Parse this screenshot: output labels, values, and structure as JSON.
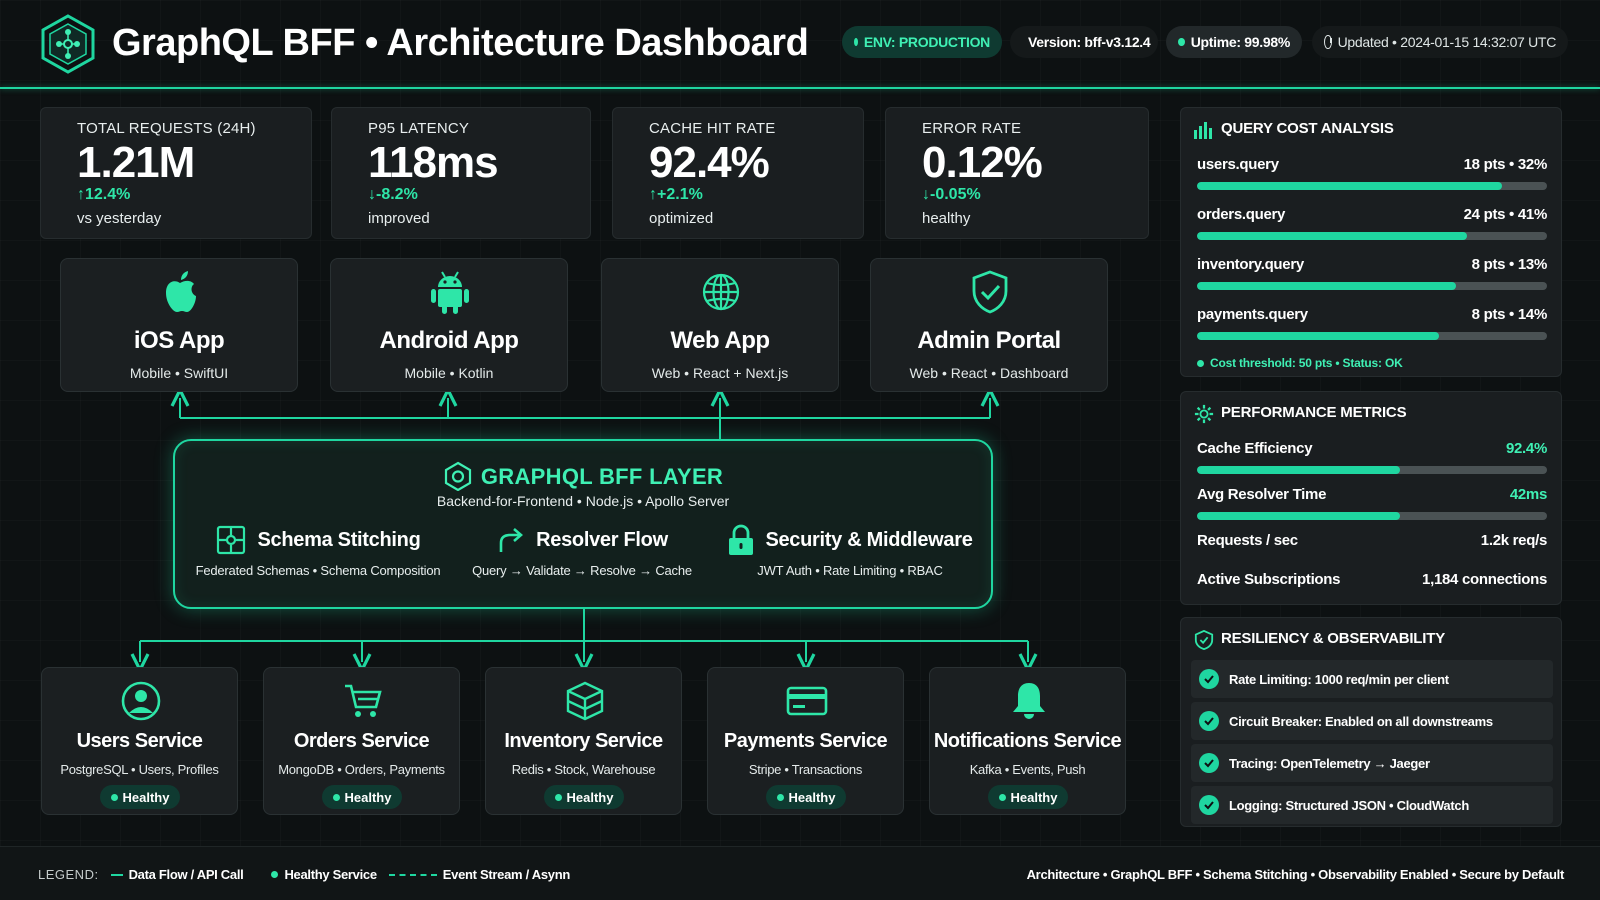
{
  "header": {
    "title": "GraphQL BFF • Architecture Dashboard",
    "env": "ENV: PRODUCTION",
    "version": "Version: bff-v3.12.4",
    "uptime": "Uptime: 99.98%",
    "updated": "Updated • 2024-01-15 14:32:07 UTC"
  },
  "kpis": [
    {
      "label": "TOTAL REQUESTS (24H)",
      "value": "1.21M",
      "change": "↑12.4%",
      "sub": "vs yesterday"
    },
    {
      "label": "P95 LATENCY",
      "value": "118ms",
      "change": "↓-8.2%",
      "sub": "improved"
    },
    {
      "label": "CACHE HIT RATE",
      "value": "92.4%",
      "change": "↑+2.1%",
      "sub": "optimized"
    },
    {
      "label": "ERROR RATE",
      "value": "0.12%",
      "change": "↓-0.05%",
      "sub": "healthy"
    }
  ],
  "clients": [
    {
      "name": "iOS App",
      "sub": "Mobile • SwiftUI",
      "icon": "apple-icon"
    },
    {
      "name": "Android App",
      "sub": "Mobile • Kotlin",
      "icon": "android-icon"
    },
    {
      "name": "Web App",
      "sub": "Web • React + Next.js",
      "icon": "globe-icon"
    },
    {
      "name": "Admin Portal",
      "sub": "Web • React • Dashboard",
      "icon": "shield-check-icon"
    }
  ],
  "bff": {
    "title": "GRAPHQL BFF LAYER",
    "sub": "Backend-for-Frontend • Node.js • Apollo Server",
    "features": [
      {
        "name": "Schema Stitching",
        "sub": "Federated Schemas • Schema Composition",
        "icon": "puzzle-icon"
      },
      {
        "name": "Resolver Flow",
        "sub": "Query → Validate → Resolve → Cache",
        "icon": "arrow-forward-icon"
      },
      {
        "name": "Security & Middleware",
        "sub": "JWT Auth • Rate Limiting • RBAC",
        "icon": "lock-icon"
      }
    ]
  },
  "services": [
    {
      "name": "Users Service",
      "sub": "PostgreSQL • Users, Profiles",
      "status": "Healthy",
      "icon": "user-icon"
    },
    {
      "name": "Orders Service",
      "sub": "MongoDB • Orders, Payments",
      "status": "Healthy",
      "icon": "cart-icon"
    },
    {
      "name": "Inventory Service",
      "sub": "Redis • Stock, Warehouse",
      "status": "Healthy",
      "icon": "box-icon"
    },
    {
      "name": "Payments Service",
      "sub": "Stripe • Transactions",
      "status": "Healthy",
      "icon": "credit-card-icon"
    },
    {
      "name": "Notifications Service",
      "sub": "Kafka • Events, Push",
      "status": "Healthy",
      "icon": "bell-icon"
    }
  ],
  "query_cost": {
    "title": "QUERY COST ANALYSIS",
    "items": [
      {
        "name": "users.query",
        "value": "18 pts • 32%",
        "fill": 0.87
      },
      {
        "name": "orders.query",
        "value": "24 pts • 41%",
        "fill": 0.77
      },
      {
        "name": "inventory.query",
        "value": "8 pts • 13%",
        "fill": 0.74
      },
      {
        "name": "payments.query",
        "value": "8 pts • 14%",
        "fill": 0.69
      }
    ],
    "threshold": "Cost threshold: 50 pts • Status: OK"
  },
  "performance": {
    "title": "PERFORMANCE METRICS",
    "items": [
      {
        "name": "Cache Efficiency",
        "value": "92.4%",
        "fill": 0.58
      },
      {
        "name": "Avg Resolver Time",
        "value": "42ms",
        "fill": 0.58
      },
      {
        "name": "Requests / sec",
        "value": "1.2k req/s"
      },
      {
        "name": "Active Subscriptions",
        "value": "1,184 connections"
      }
    ]
  },
  "resiliency": {
    "title": "RESILIENCY & OBSERVABILITY",
    "items": [
      "Rate Limiting: 1000 req/min per client",
      "Circuit Breaker: Enabled on all downstreams",
      "Tracing: OpenTelemetry → Jaeger",
      "Logging: Structured JSON • CloudWatch"
    ]
  },
  "footer": {
    "legend_title": "LEGEND:",
    "legend_flow": "Data Flow / API Call",
    "legend_healthy": "Healthy Service",
    "legend_event": "Event Stream / Asynn",
    "right": "Architecture • GraphQL BFF • Schema Stitching • Observability Enabled • Secure by Default"
  },
  "colors": {
    "accent": "#1fd6a0",
    "accent_text": "#3ff0b4",
    "background": "#0d1112",
    "card": "#1a1e20"
  }
}
